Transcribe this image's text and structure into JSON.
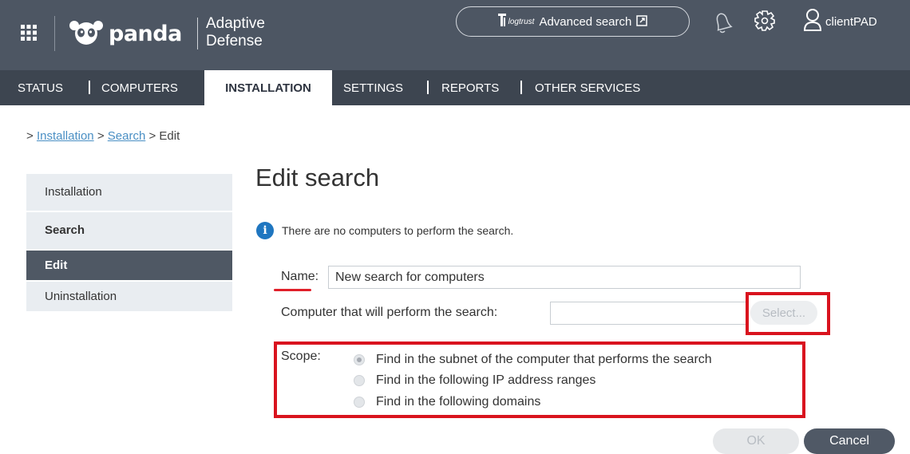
{
  "header": {
    "logo_text": "panda",
    "product_line1": "Adaptive",
    "product_line2": "Defense",
    "advanced_search": {
      "brand": "logtrust",
      "label": "Advanced search"
    },
    "user_name": "clientPAD",
    "icons": [
      "apps-grid-icon",
      "panda-logo-icon",
      "logtrust-icon",
      "external-link-icon",
      "bell-icon",
      "settings-gear-icon",
      "user-icon"
    ]
  },
  "nav": {
    "items": [
      {
        "label": "STATUS"
      },
      {
        "label": "COMPUTERS"
      },
      {
        "label": "INSTALLATION"
      },
      {
        "label": "SETTINGS"
      },
      {
        "label": "REPORTS"
      },
      {
        "label": "OTHER SERVICES"
      }
    ],
    "active": "INSTALLATION"
  },
  "breadcrumb": {
    "prefix": ">",
    "links": [
      "Installation",
      "Search"
    ],
    "separator": ">",
    "current": "Edit"
  },
  "sidebar": {
    "items": [
      {
        "label": "Installation"
      },
      {
        "label": "Search"
      },
      {
        "label": "Edit"
      },
      {
        "label": "Uninstallation"
      }
    ],
    "active": "Edit"
  },
  "main": {
    "title": "Edit search",
    "info_message": "There are no computers to perform the search.",
    "name_label": "Name:",
    "name_value": "New search for computers",
    "computer_label": "Computer that will perform the search:",
    "computer_value": "",
    "select_label": "Select...",
    "scope_label": "Scope:",
    "scope_options": [
      {
        "label": "Find in the subnet of the computer that performs the search",
        "selected": true
      },
      {
        "label": "Find in the following IP address ranges",
        "selected": false
      },
      {
        "label": "Find in the following domains",
        "selected": false
      }
    ],
    "ok_label": "OK",
    "cancel_label": "Cancel"
  },
  "colors": {
    "header_bg": "#4d5663",
    "nav_bg": "#3d4550",
    "highlight_red": "#d9131e",
    "info_blue": "#1f76c0",
    "link_blue": "#4a8fc4"
  }
}
